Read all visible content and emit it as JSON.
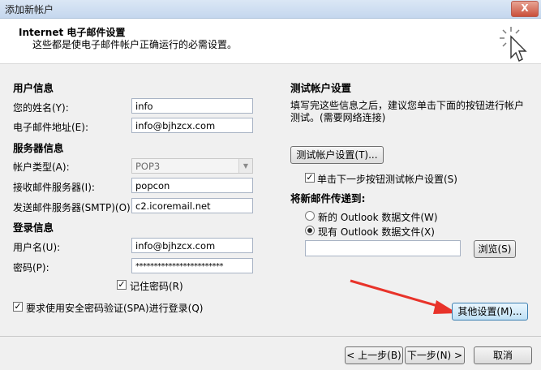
{
  "window": {
    "title": "添加新帐户",
    "close_label": "X"
  },
  "header": {
    "title": "Internet 电子邮件设置",
    "subtitle": "这些都是使电子邮件帐户正确运行的必需设置。"
  },
  "user_info": {
    "heading": "用户信息",
    "name_label": "您的姓名(Y):",
    "name_value": "info",
    "email_label": "电子邮件地址(E):",
    "email_value": "info@bjhzcx.com"
  },
  "server_info": {
    "heading": "服务器信息",
    "account_type_label": "帐户类型(A):",
    "account_type_value": "POP3",
    "incoming_label": "接收邮件服务器(I):",
    "incoming_value": "popcon",
    "outgoing_label": "发送邮件服务器(SMTP)(O):",
    "outgoing_value": "c2.icoremail.net"
  },
  "login_info": {
    "heading": "登录信息",
    "username_label": "用户名(U):",
    "username_value": "info@bjhzcx.com",
    "password_label": "密码(P):",
    "password_value": "************************",
    "remember_label": "记住密码(R)",
    "remember_checked": true,
    "spa_label": "要求使用安全密码验证(SPA)进行登录(Q)",
    "spa_checked": true
  },
  "test": {
    "heading": "测试帐户设置",
    "description_line1": "填写完这些信息之后，建议您单击下面的按钮进行帐户",
    "description_line2": "测试。(需要网络连接)",
    "test_button": "测试帐户设置(T)...",
    "auto_test_label": "单击下一步按钮测试帐户设置(S)",
    "auto_test_checked": true
  },
  "deliver": {
    "heading": "将新邮件传递到:",
    "option_new": "新的 Outlook 数据文件(W)",
    "option_existing": "现有 Outlook 数据文件(X)",
    "selected": "existing",
    "path_value": "",
    "browse_button": "浏览(S)"
  },
  "more_settings_button": "其他设置(M)...",
  "footer": {
    "back_button": "< 上一步(B)",
    "next_button": "下一步(N) >",
    "cancel_button": "取消"
  },
  "colors": {
    "annotation_arrow": "#e8332a",
    "focus_button": "#3c7fb1"
  },
  "icons": {
    "header_icon": "cursor-click-icon"
  }
}
